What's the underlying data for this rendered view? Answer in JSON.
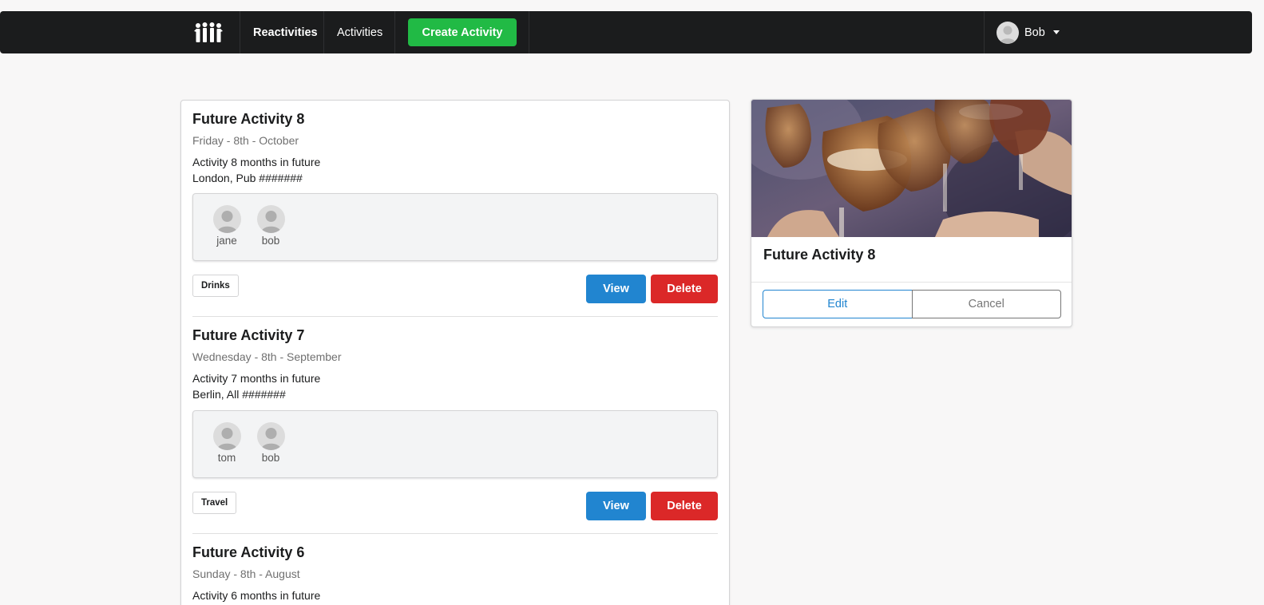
{
  "nav": {
    "brand": "Reactivities",
    "activities": "Activities",
    "create": "Create Activity",
    "user": "Bob",
    "logo_icon": "people-group-icon"
  },
  "activities": [
    {
      "title": "Future Activity 8",
      "date": "Friday - 8th - October",
      "description": "Activity 8 months in future",
      "location": "London, Pub #######",
      "attendees": [
        "jane",
        "bob"
      ],
      "category": "Drinks",
      "view_label": "View",
      "delete_label": "Delete"
    },
    {
      "title": "Future Activity 7",
      "date": "Wednesday - 8th - September",
      "description": "Activity 7 months in future",
      "location": "Berlin, All #######",
      "attendees": [
        "tom",
        "bob"
      ],
      "category": "Travel",
      "view_label": "View",
      "delete_label": "Delete"
    },
    {
      "title": "Future Activity 6",
      "date": "Sunday - 8th - August",
      "description": "Activity 6 months in future"
    }
  ],
  "detail": {
    "title": "Future Activity 8",
    "edit_label": "Edit",
    "cancel_label": "Cancel",
    "image": "drinks-toast-photo"
  },
  "colors": {
    "navbar": "#1b1c1d",
    "green": "#21ba45",
    "blue": "#2185d0",
    "red": "#db2828"
  }
}
